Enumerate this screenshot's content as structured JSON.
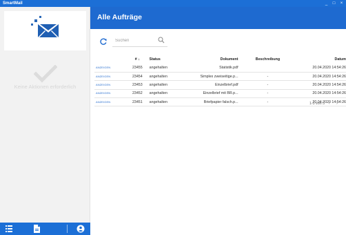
{
  "window": {
    "title": "SmartMail",
    "controls": {
      "minimize": "_",
      "maximize": "□",
      "close": "×"
    }
  },
  "sidebar": {
    "empty_text": "Keine Aktionen erforderlich",
    "footer_icons": [
      "list-icon",
      "document-icon",
      "user-account-icon"
    ]
  },
  "header": {
    "title": "Alle Aufträge"
  },
  "toolbar": {
    "search_placeholder": "Suchen"
  },
  "table": {
    "columns": {
      "nr": "# ↓",
      "status": "Status",
      "document": "Dokument",
      "description": "Beschreibung",
      "date": "Datum"
    },
    "rows": [
      {
        "action": "ANZEIGEN",
        "nr": "23455",
        "status": "angehalten",
        "document": "Statistik.pdf",
        "description": "",
        "date": "20.04.2020 14:54:26"
      },
      {
        "action": "ANZEIGEN",
        "nr": "23454",
        "status": "angehalten",
        "document": "Simplex zweiseitige.p...",
        "description": "-",
        "date": "20.04.2020 14:54:26"
      },
      {
        "action": "ANZEIGEN",
        "nr": "23453",
        "status": "angehalten",
        "document": "Einzelbrief.pdf",
        "description": "-",
        "date": "20.04.2020 14:54:26"
      },
      {
        "action": "ANZEIGEN",
        "nr": "23452",
        "status": "angehalten",
        "document": "Einzelbrief mit BR.p...",
        "description": "-",
        "date": "20.04.2020 14:54:26"
      },
      {
        "action": "ANZEIGEN",
        "nr": "23451",
        "status": "angehalten",
        "document": "Briefpapier falsch.p...",
        "description": "-",
        "date": "20.04.2020 14:54:26"
      }
    ]
  },
  "pagination": {
    "range": "1-5 von 5",
    "prev": "‹",
    "next": "›"
  },
  "colors": {
    "accent": "#1e6ad0",
    "titlebar": "#1c6fd6",
    "link": "#2a6fcf"
  }
}
